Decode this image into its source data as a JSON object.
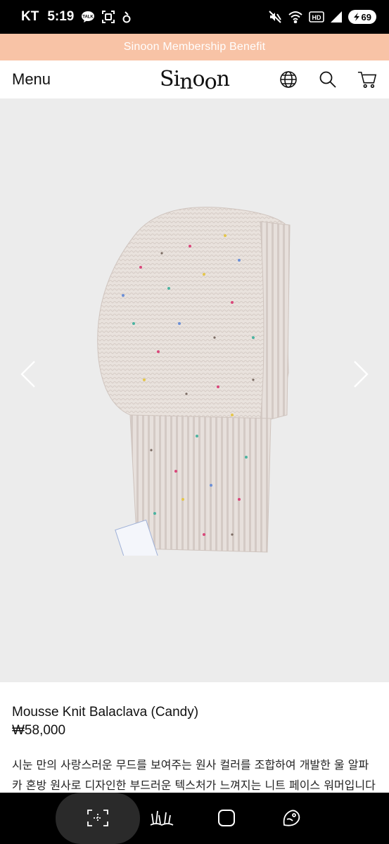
{
  "status_bar": {
    "carrier": "KT",
    "time": "5:19",
    "battery": "69",
    "left_icons": [
      "talk-icon",
      "screenshot-icon",
      "gesture-icon"
    ],
    "right_icons": [
      "mute-icon",
      "wifi-icon",
      "hd-icon",
      "signal-icon"
    ]
  },
  "promo": {
    "text": "Sinoon Membership Benefit"
  },
  "header": {
    "menu_label": "Menu",
    "logo_text": "Sinoon",
    "icons": [
      "globe-icon",
      "search-icon",
      "cart-icon"
    ]
  },
  "gallery": {
    "prev_icon": "chevron-left-icon",
    "next_icon": "chevron-right-icon",
    "background": "#ececec"
  },
  "product": {
    "name": "Mousse Knit Balaclava (Candy)",
    "price": "₩58,000",
    "description": "시눈 만의 사랑스러운 무드를 보여주는 원사 컬러를 조합하여 개발한 울 알파카 혼방 원사로 디자인한 부드러운 텍스처가 느껴지는 니트 페이스 워머입니다"
  },
  "navbar": {
    "icons": [
      "scan-icon",
      "grass-icon",
      "home-icon",
      "assistant-icon"
    ]
  },
  "colors": {
    "promo_bg": "#f8c3a6",
    "promo_text": "#ffffff",
    "status_bg": "#000000"
  }
}
